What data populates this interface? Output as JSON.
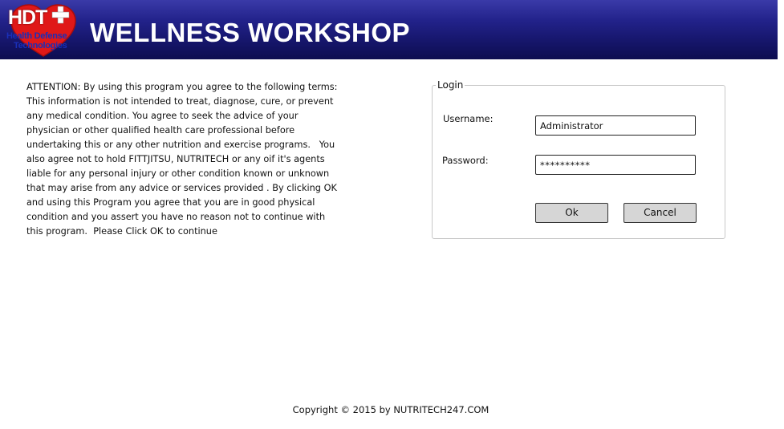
{
  "header": {
    "logo": {
      "abbr": "HDT",
      "line1": "Health Defense",
      "line2": "Technologies",
      "icon": "heart-cross-icon"
    },
    "title": "WELLNESS WORKSHOP"
  },
  "notice": {
    "text": "ATTENTION: By using this program you agree to the following terms:  This information is not intended to treat, diagnose, cure, or prevent any medical condition. You agree to seek the advice of your physician or other qualified health care professional before undertaking this or any other nutrition and exercise programs.   You also agree not to hold FITTJITSU, NUTRITECH or any oif it's agents liable for any personal injury or other condition known or unknown that may arise from any advice or services provided . By clicking OK and using this Program you agree that you are in good physical condition and you assert you have no reason not to continue with this program.  Please Click OK to continue"
  },
  "login": {
    "legend": "Login",
    "username_label": "Username:",
    "username_value": "Administrator",
    "password_label": "Password:",
    "password_value": "**********",
    "ok_label": "Ok",
    "cancel_label": "Cancel"
  },
  "footer": {
    "copyright": "Copyright © 2015 by NUTRITECH247.COM"
  },
  "colors": {
    "header_top": "#3a3aa8",
    "header_bottom": "#0d0d50",
    "logo_heart": "#e01818",
    "logo_text": "#1a2fb8",
    "button_bg": "#d6d6d6"
  }
}
